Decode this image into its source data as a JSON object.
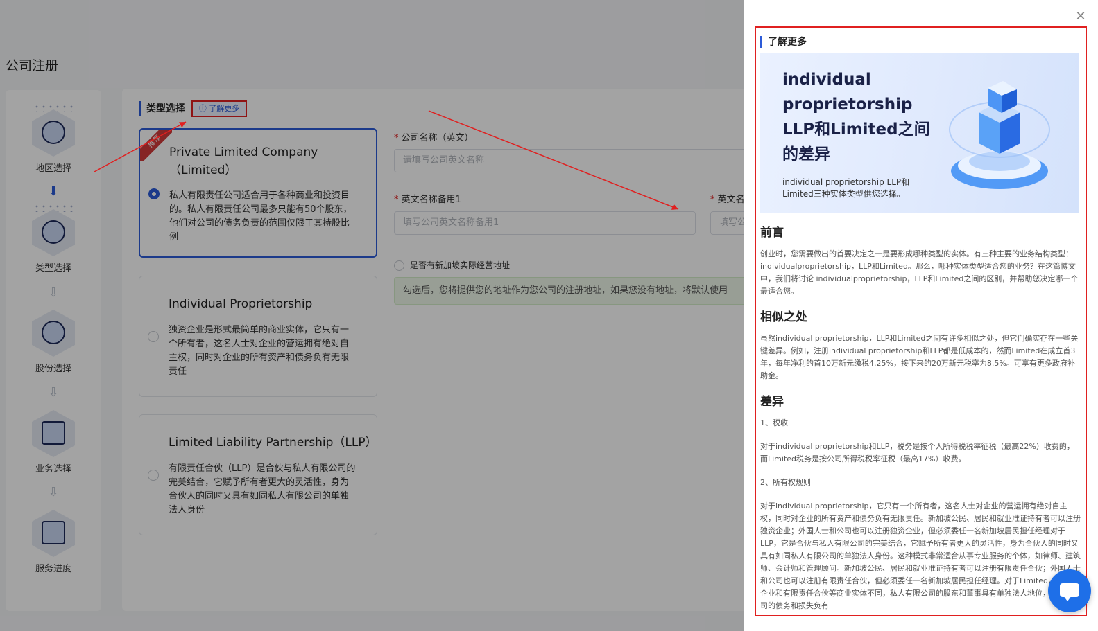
{
  "page": {
    "title": "公司注册"
  },
  "steps": [
    {
      "label": "地区选择"
    },
    {
      "label": "类型选择"
    },
    {
      "label": "股份选择"
    },
    {
      "label": "业务选择"
    },
    {
      "label": "服务进度"
    }
  ],
  "type_section": {
    "heading": "类型选择",
    "learn_more": "ⓘ 了解更多",
    "cards": [
      {
        "ribbon": "推荐",
        "title_line1": "Private Limited Company",
        "title_line2": "（Limited）",
        "description": "私人有限责任公司适合用于各种商业和投资目的。私人有限责任公司最多只能有50个股东，他们对公司的债务负责的范围仅限于其持股比例",
        "selected": true
      },
      {
        "title_line1": "Individual Proprietorship",
        "description": "独资企业是形式最简单的商业实体，它只有一个所有者，这名人士对企业的营运拥有绝对自主权，同时对企业的所有资产和债务负有无限责任",
        "selected": false
      },
      {
        "title_line1": "Limited Liability Partnership（LLP）",
        "description": "有限责任合伙（LLP）是合伙与私人有限公司的完美结合，它赋予所有者更大的灵活性，身为合伙人的同时又具有如同私人有限公司的单独法人身份",
        "selected": false
      }
    ]
  },
  "form": {
    "company_name_label": "公司名称（英文）",
    "company_name_placeholder": "请填写公司英文名称",
    "alt_name1_label": "英文名称备用1",
    "alt_name1_placeholder": "填写公司英文名称备用1",
    "alt_name2_label": "英文名",
    "alt_name2_placeholder": "填写公",
    "address_checkbox_label": "是否有新加坡实际经营地址",
    "notice": "勾选后，您将提供您的地址作为您公司的注册地址，如果您没有地址，将默认使用"
  },
  "drawer": {
    "heading": "了解更多",
    "banner_title": "individual proprietorship LLP和Limited之间的差异",
    "banner_subtitle": "individual proprietorship LLP和Limited三种实体类型供您选择。",
    "sections": {
      "preface_title": "前言",
      "preface_text": "创业时，您需要做出的首要决定之一是要形成哪种类型的实体。有三种主要的业务结构类型：individualproprietorship，LLP和Limited。那么，哪种实体类型适合您的业务？在这篇博文中，我们将讨论 individualproprietorship，LLP和Limited之间的区别，并帮助您决定哪一个最适合您。",
      "similar_title": "相似之处",
      "similar_text": "虽然individual proprietorship，LLP和Limited之间有许多相似之处，但它们确实存在一些关键差异。例如，注册individual proprietorship和LLP都是低成本的，然而Limited在成立首3年，每年净利的首10万新元缴税4.25%，接下来的20万新元税率为8.5%。可享有更多政府补助金。",
      "diff_title": "差异",
      "diff_item1": "1、税收",
      "diff_item1_text": "对于individual proprietorship和LLP，税务是按个人所得税税率征税（最高22%）收费的，而Limited税务是按公司所得税税率征税（最高17%）收费。",
      "diff_item2": "2、所有权规则",
      "diff_item2_text": "对于individual proprietorship，它只有一个所有者，这名人士对企业的营运拥有绝对自主权，同时对企业的所有资产和债务负有无限责任。新加坡公民、居民和就业准证持有者可以注册独资企业；外国人士和公司也可以注册独资企业，但必须委任一名新加坡居民担任经理对于LLP，它是合伙与私人有限公司的完美结合，它赋予所有者更大的灵活性，身为合伙人的同时又具有如同私人有限公司的单独法人身份。这种模式非常适合从事专业服务的个体，如律师、建筑师、会计师和管理顾问。新加坡公民、居民和就业准证持有者可以注册有限责任合伙；外国人士和公司也可以注册有限责任合伙，但必须委任一名新加坡居民担任经理。对于Limited，与独资企业和有限责任合伙等商业实体不同，私人有限公司的股东和董事具有单独法人地位，他们对公司的债务和损失负有"
    }
  },
  "colors": {
    "accent": "#2c5bd8",
    "highlight_red": "#e02020",
    "chat_blue": "#1e6fe8"
  }
}
